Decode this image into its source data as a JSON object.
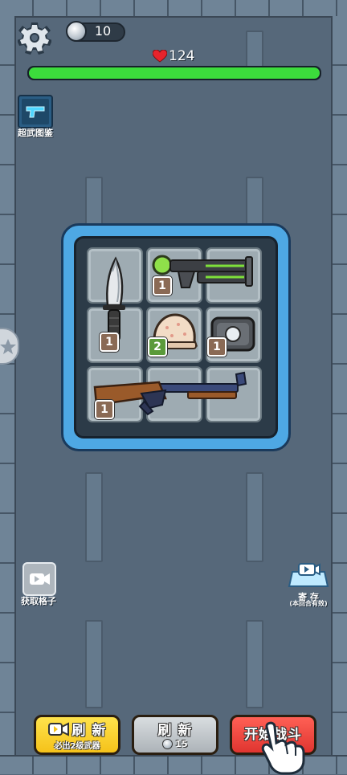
{
  "hud": {
    "coins": "10",
    "health": "124",
    "health_fraction": 1.0,
    "health_color": "#3cdc3c"
  },
  "side": {
    "codex_label": "超武图鉴",
    "get_slot_label": "获取格子",
    "stash_label": "寄 存",
    "stash_note": "(本回合有效)"
  },
  "board": {
    "cols": 3,
    "rows": 3,
    "items": [
      {
        "name": "combat-knife",
        "level": "1"
      },
      {
        "name": "plasma-rifle",
        "level": "1"
      },
      {
        "name": "army-helmet",
        "level": "2"
      },
      {
        "name": "armor-plate",
        "level": "1"
      },
      {
        "name": "shotgun",
        "level": "1"
      }
    ]
  },
  "buttons": {
    "refresh_video_label": "刷 新",
    "refresh_video_sub": "必出2级武器",
    "refresh_coin_label": "刷 新",
    "refresh_coin_cost": "15",
    "start_battle_label": "开始战斗"
  },
  "icons": {
    "settings": "gear-icon",
    "coin": "silver-coin-icon",
    "heart": "heart-icon",
    "video": "video-camera-icon",
    "tutorial": "pointing-hand-icon"
  }
}
